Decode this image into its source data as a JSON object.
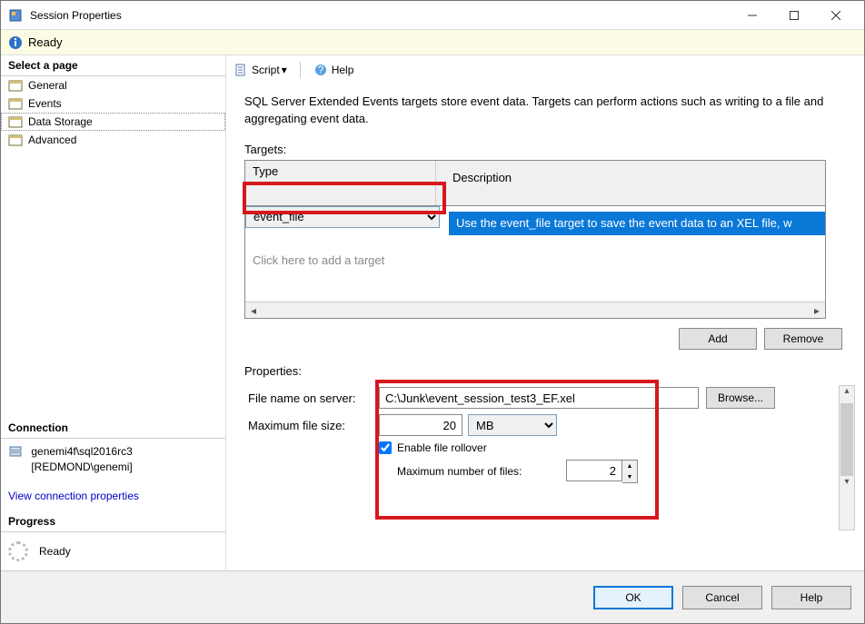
{
  "window": {
    "title": "Session Properties"
  },
  "ready": {
    "label": "Ready"
  },
  "left": {
    "select_page": "Select a page",
    "pages": [
      "General",
      "Events",
      "Data Storage",
      "Advanced"
    ],
    "selected_index": 2,
    "connection_head": "Connection",
    "server": "genemi4f\\sql2016rc3",
    "user": "[REDMOND\\genemi]",
    "view_conn": "View connection properties",
    "progress_head": "Progress",
    "progress_status": "Ready"
  },
  "toolbar": {
    "script": "Script",
    "help": "Help"
  },
  "main": {
    "intro": "SQL Server Extended Events targets store event data. Targets can perform actions such as writing to a file and aggregating event data.",
    "targets_label": "Targets:",
    "th_type": "Type",
    "th_desc": "Description",
    "row_type": "event_file",
    "row_desc": "Use the event_file target to save the event data to an XEL file, w",
    "add_placeholder": "Click here to add a target",
    "add_btn": "Add",
    "remove_btn": "Remove",
    "properties_label": "Properties:",
    "fname_label": "File name on server:",
    "fname_value": "C:\\Junk\\event_session_test3_EF.xel",
    "browse_btn": "Browse...",
    "size_label": "Maximum file size:",
    "size_value": "20",
    "size_unit": "MB",
    "rollover_label": "Enable file rollover",
    "rollover_checked": true,
    "maxfiles_label": "Maximum number of files:",
    "maxfiles_value": "2"
  },
  "bottom": {
    "ok": "OK",
    "cancel": "Cancel",
    "help": "Help"
  }
}
